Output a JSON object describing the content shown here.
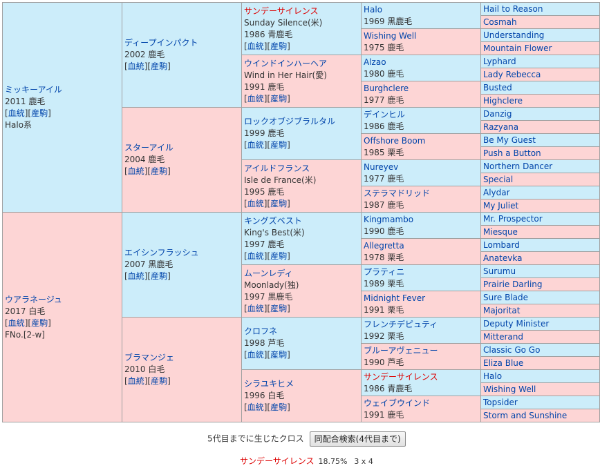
{
  "links": {
    "bloodline": "血統",
    "foal": "産駒"
  },
  "horse": {
    "name": "ミッキーアイル",
    "year": "2011",
    "color": "鹿毛",
    "line": "Halo系"
  },
  "sire": {
    "name": "ディープインパクト",
    "year": "2002",
    "color": "鹿毛"
  },
  "dam": {
    "name": "スターアイル",
    "year": "2004",
    "color": "鹿毛"
  },
  "s_sire": {
    "name": "サンデーサイレンス",
    "en": "Sunday Silence(米)",
    "year": "1986",
    "color": "青鹿毛"
  },
  "s_dam": {
    "name": "ウインドインハーヘア",
    "en": "Wind in Her Hair(愛)",
    "year": "1991",
    "color": "鹿毛"
  },
  "d_sire": {
    "name": "ロックオブジブラルタル",
    "year": "1999",
    "color": "鹿毛"
  },
  "d_dam": {
    "name": "アイルドフランス",
    "en": "Isle de France(米)",
    "year": "1995",
    "color": "鹿毛"
  },
  "mare": {
    "name": "ウアラネージュ",
    "year": "2017",
    "color": "白毛",
    "fno": "FNo.[2-w]"
  },
  "m_sire": {
    "name": "エイシンフラッシュ",
    "year": "2007",
    "color": "黒鹿毛"
  },
  "m_dam": {
    "name": "ブラマンジェ",
    "year": "2010",
    "color": "白毛"
  },
  "ms_sire": {
    "name": "キングズベスト",
    "en": "King's Best(米)",
    "year": "1997",
    "color": "鹿毛"
  },
  "ms_dam": {
    "name": "ムーンレディ",
    "en": "Moonlady(独)",
    "year": "1997",
    "color": "黒鹿毛"
  },
  "md_sire": {
    "name": "クロフネ",
    "year": "1998",
    "color": "芦毛"
  },
  "md_dam": {
    "name": "シラユキヒメ",
    "year": "1996",
    "color": "白毛"
  },
  "g4": [
    {
      "name": "Halo",
      "year": "1969",
      "color": "黒鹿毛"
    },
    {
      "name": "Wishing Well",
      "year": "1975",
      "color": "鹿毛"
    },
    {
      "name": "Alzao",
      "year": "1980",
      "color": "鹿毛"
    },
    {
      "name": "Burghclere",
      "year": "1977",
      "color": "鹿毛"
    },
    {
      "name": "デインヒル",
      "year": "1986",
      "color": "鹿毛"
    },
    {
      "name": "Offshore Boom",
      "year": "1985",
      "color": "栗毛"
    },
    {
      "name": "Nureyev",
      "year": "1977",
      "color": "鹿毛"
    },
    {
      "name": "ステラマドリッド",
      "year": "1987",
      "color": "鹿毛"
    },
    {
      "name": "Kingmambo",
      "year": "1990",
      "color": "鹿毛"
    },
    {
      "name": "Allegretta",
      "year": "1978",
      "color": "栗毛"
    },
    {
      "name": "プラティニ",
      "year": "1989",
      "color": "栗毛"
    },
    {
      "name": "Midnight Fever",
      "year": "1991",
      "color": "栗毛"
    },
    {
      "name": "フレンチデピュティ",
      "year": "1992",
      "color": "栗毛"
    },
    {
      "name": "ブルーアヴェニュー",
      "year": "1990",
      "color": "芦毛"
    },
    {
      "name": "サンデーサイレンス",
      "year": "1986",
      "color": "青鹿毛"
    },
    {
      "name": "ウェイブウインド",
      "year": "1991",
      "color": "鹿毛"
    }
  ],
  "g5": [
    "Hail to Reason",
    "Cosmah",
    "Understanding",
    "Mountain Flower",
    "Lyphard",
    "Lady Rebecca",
    "Busted",
    "Highclere",
    "Danzig",
    "Razyana",
    "Be My Guest",
    "Push a Button",
    "Northern Dancer",
    "Special",
    "Alydar",
    "My Juliet",
    "Mr. Prospector",
    "Miesque",
    "Lombard",
    "Anatevka",
    "Surumu",
    "Prairie Darling",
    "Sure Blade",
    "Majoritat",
    "Deputy Minister",
    "Mitterand",
    "Classic Go Go",
    "Eliza Blue",
    "Halo",
    "Wishing Well",
    "Topsider",
    "Storm and Sunshine"
  ],
  "footer": {
    "cross_label": "5代目までに生じたクロス",
    "button": "同配合検索(4代目まで)",
    "cross_name": "サンデーサイレンス",
    "cross_pct": "18.75%",
    "cross_gen": "3 x 4"
  }
}
